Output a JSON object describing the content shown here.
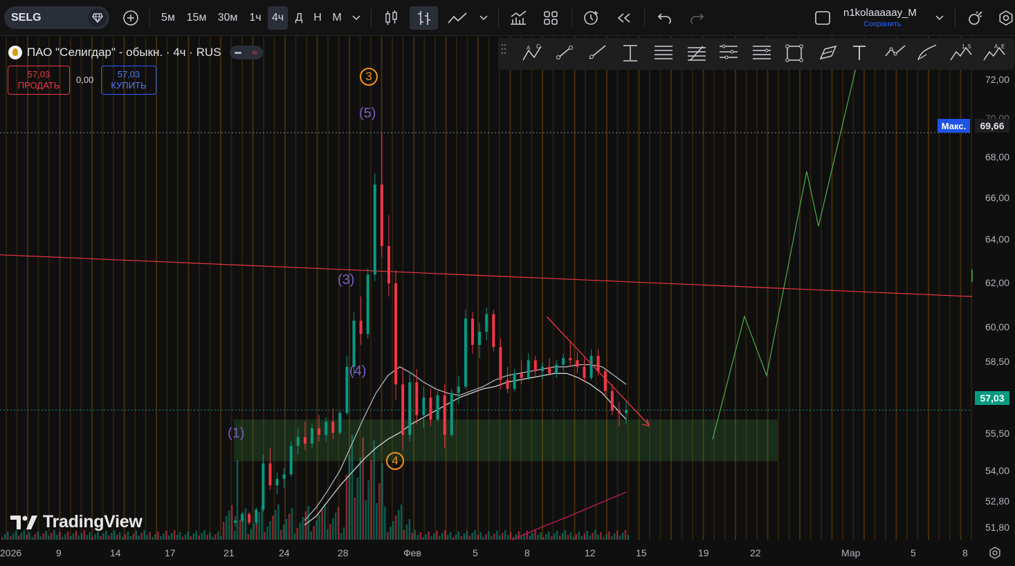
{
  "toolbar": {
    "symbol": "SELG",
    "intervals": [
      "5м",
      "15м",
      "30м",
      "1ч",
      "4ч",
      "Д",
      "Н",
      "М"
    ],
    "active_interval": "4ч",
    "user": "n1kolaaaaay_M",
    "save_label": "Сохранить"
  },
  "legend": {
    "title": "ПАО \"Селигдар\" - обыкн. · 4ч · RUS",
    "sell_price": "57,03",
    "sell_label": "ПРОДАТЬ",
    "spread": "0,00",
    "buy_price": "57,03",
    "buy_label": "КУПИТЬ"
  },
  "price_axis": {
    "labels": [
      "72,00",
      "70,00",
      "68,00",
      "66,00",
      "64,00",
      "62,00",
      "60,00",
      "58,50",
      "55,50",
      "54,00",
      "52,80",
      "51,80"
    ],
    "max_label": "Макс.",
    "max_value": "69,66",
    "current_value": "57,03"
  },
  "time_axis": {
    "labels": [
      "2026",
      "9",
      "14",
      "17",
      "21",
      "24",
      "28",
      "Фев",
      "5",
      "8",
      "12",
      "15",
      "19",
      "22",
      "Мар",
      "5",
      "8"
    ]
  },
  "annotations": {
    "wave_labels": [
      "(1)",
      "(3)",
      "(4)",
      "(5)"
    ],
    "circle_labels": [
      "3",
      "4"
    ]
  },
  "watermark": "TradingView",
  "chart_data": {
    "type": "candlestick",
    "title": "ПАО \"Селигдар\" - обыкн. · 4ч · RUS",
    "symbol": "SELG",
    "interval": "4ч",
    "last_price": 57.03,
    "max_price": 69.66,
    "candles": [
      {
        "o": 51.9,
        "h": 52.2,
        "l": 51.7,
        "c": 52.0
      },
      {
        "o": 52.0,
        "h": 52.4,
        "l": 51.9,
        "c": 52.3
      },
      {
        "o": 52.3,
        "h": 52.4,
        "l": 51.8,
        "c": 51.9
      },
      {
        "o": 51.9,
        "h": 52.6,
        "l": 51.8,
        "c": 52.5
      },
      {
        "o": 52.5,
        "h": 55.0,
        "l": 52.4,
        "c": 54.6
      },
      {
        "o": 54.6,
        "h": 55.3,
        "l": 53.4,
        "c": 53.6
      },
      {
        "o": 53.6,
        "h": 54.2,
        "l": 53.2,
        "c": 53.9
      },
      {
        "o": 53.9,
        "h": 54.4,
        "l": 53.5,
        "c": 54.1
      },
      {
        "o": 54.1,
        "h": 55.6,
        "l": 54.0,
        "c": 55.4
      },
      {
        "o": 55.4,
        "h": 56.2,
        "l": 55.0,
        "c": 55.8
      },
      {
        "o": 55.8,
        "h": 56.5,
        "l": 55.2,
        "c": 55.5
      },
      {
        "o": 55.5,
        "h": 56.4,
        "l": 55.3,
        "c": 56.2
      },
      {
        "o": 56.2,
        "h": 56.8,
        "l": 55.6,
        "c": 55.9
      },
      {
        "o": 55.9,
        "h": 56.7,
        "l": 55.6,
        "c": 56.5
      },
      {
        "o": 56.5,
        "h": 57.1,
        "l": 55.7,
        "c": 56.0
      },
      {
        "o": 56.0,
        "h": 57.0,
        "l": 55.9,
        "c": 56.9
      },
      {
        "o": 56.9,
        "h": 59.5,
        "l": 56.8,
        "c": 59.0
      },
      {
        "o": 59.0,
        "h": 61.5,
        "l": 58.6,
        "c": 61.1
      },
      {
        "o": 61.1,
        "h": 62.2,
        "l": 60.0,
        "c": 60.5
      },
      {
        "o": 60.5,
        "h": 63.5,
        "l": 60.3,
        "c": 63.2
      },
      {
        "o": 63.2,
        "h": 67.8,
        "l": 62.9,
        "c": 67.3
      },
      {
        "o": 67.3,
        "h": 69.66,
        "l": 64.0,
        "c": 64.5
      },
      {
        "o": 64.5,
        "h": 65.9,
        "l": 62.2,
        "c": 62.8
      },
      {
        "o": 62.8,
        "h": 63.4,
        "l": 57.5,
        "c": 58.2
      },
      {
        "o": 58.2,
        "h": 59.0,
        "l": 55.2,
        "c": 55.9
      },
      {
        "o": 55.9,
        "h": 58.8,
        "l": 55.6,
        "c": 58.3
      },
      {
        "o": 58.3,
        "h": 58.9,
        "l": 56.4,
        "c": 56.8
      },
      {
        "o": 56.8,
        "h": 58.1,
        "l": 56.2,
        "c": 57.6
      },
      {
        "o": 57.6,
        "h": 58.0,
        "l": 56.3,
        "c": 56.6
      },
      {
        "o": 56.6,
        "h": 57.9,
        "l": 56.5,
        "c": 57.7
      },
      {
        "o": 57.7,
        "h": 58.2,
        "l": 55.3,
        "c": 55.9
      },
      {
        "o": 55.9,
        "h": 58.0,
        "l": 55.8,
        "c": 57.8
      },
      {
        "o": 57.8,
        "h": 58.6,
        "l": 57.3,
        "c": 58.1
      },
      {
        "o": 58.1,
        "h": 61.6,
        "l": 58.0,
        "c": 61.2
      },
      {
        "o": 61.2,
        "h": 61.5,
        "l": 59.6,
        "c": 60.0
      },
      {
        "o": 60.0,
        "h": 61.0,
        "l": 59.4,
        "c": 60.6
      },
      {
        "o": 60.6,
        "h": 61.7,
        "l": 60.2,
        "c": 61.4
      },
      {
        "o": 61.4,
        "h": 61.6,
        "l": 59.7,
        "c": 59.9
      },
      {
        "o": 59.9,
        "h": 60.3,
        "l": 58.0,
        "c": 58.4
      },
      {
        "o": 58.4,
        "h": 59.0,
        "l": 57.8,
        "c": 58.0
      },
      {
        "o": 58.0,
        "h": 58.9,
        "l": 57.9,
        "c": 58.7
      },
      {
        "o": 58.7,
        "h": 59.3,
        "l": 58.2,
        "c": 58.5
      },
      {
        "o": 58.5,
        "h": 59.6,
        "l": 58.4,
        "c": 59.3
      },
      {
        "o": 59.3,
        "h": 59.5,
        "l": 58.6,
        "c": 58.8
      },
      {
        "o": 58.8,
        "h": 59.2,
        "l": 58.4,
        "c": 59.0
      },
      {
        "o": 59.0,
        "h": 59.4,
        "l": 58.6,
        "c": 58.7
      },
      {
        "o": 58.7,
        "h": 59.3,
        "l": 58.5,
        "c": 59.1
      },
      {
        "o": 59.1,
        "h": 59.6,
        "l": 58.8,
        "c": 59.4
      },
      {
        "o": 59.4,
        "h": 60.2,
        "l": 59.0,
        "c": 59.3
      },
      {
        "o": 59.3,
        "h": 59.7,
        "l": 58.7,
        "c": 59.0
      },
      {
        "o": 59.0,
        "h": 59.4,
        "l": 58.3,
        "c": 58.5
      },
      {
        "o": 58.5,
        "h": 59.8,
        "l": 58.4,
        "c": 59.5
      },
      {
        "o": 59.5,
        "h": 59.8,
        "l": 58.6,
        "c": 58.8
      },
      {
        "o": 58.8,
        "h": 58.9,
        "l": 57.6,
        "c": 57.9
      },
      {
        "o": 57.9,
        "h": 58.2,
        "l": 56.8,
        "c": 57.0
      },
      {
        "o": 57.0,
        "h": 57.4,
        "l": 56.3,
        "c": 56.9
      },
      {
        "o": 56.9,
        "h": 57.4,
        "l": 56.4,
        "c": 57.03
      }
    ],
    "ma_fast": [
      52.0,
      52.6,
      53.4,
      54.3,
      55.5,
      56.7,
      57.8,
      58.6,
      59.0,
      58.7,
      58.3,
      58.0,
      57.8,
      57.7,
      57.9,
      58.1,
      58.4,
      58.6,
      58.7,
      58.8,
      58.9,
      59.0,
      59.0,
      59.1,
      59.1,
      59.0,
      58.6,
      58.2
    ],
    "ma_slow": [
      51.8,
      52.2,
      52.9,
      53.6,
      54.2,
      54.8,
      55.3,
      55.7,
      56.0,
      56.4,
      56.7,
      57.0,
      57.3,
      57.6,
      57.8,
      58.0,
      58.1,
      58.3,
      58.4,
      58.5,
      58.6,
      58.7,
      58.7,
      58.5,
      58.2,
      57.8,
      57.2,
      56.6
    ],
    "resistance_line": {
      "start": 64.1,
      "end": 62.2
    },
    "support_zone": {
      "low": 54.7,
      "high": 56.6
    },
    "forecast_path": [
      55.7,
      61.3,
      58.6,
      67.9,
      65.4,
      73.0
    ],
    "ylim": [
      51.0,
      73.5
    ],
    "grid": false
  }
}
